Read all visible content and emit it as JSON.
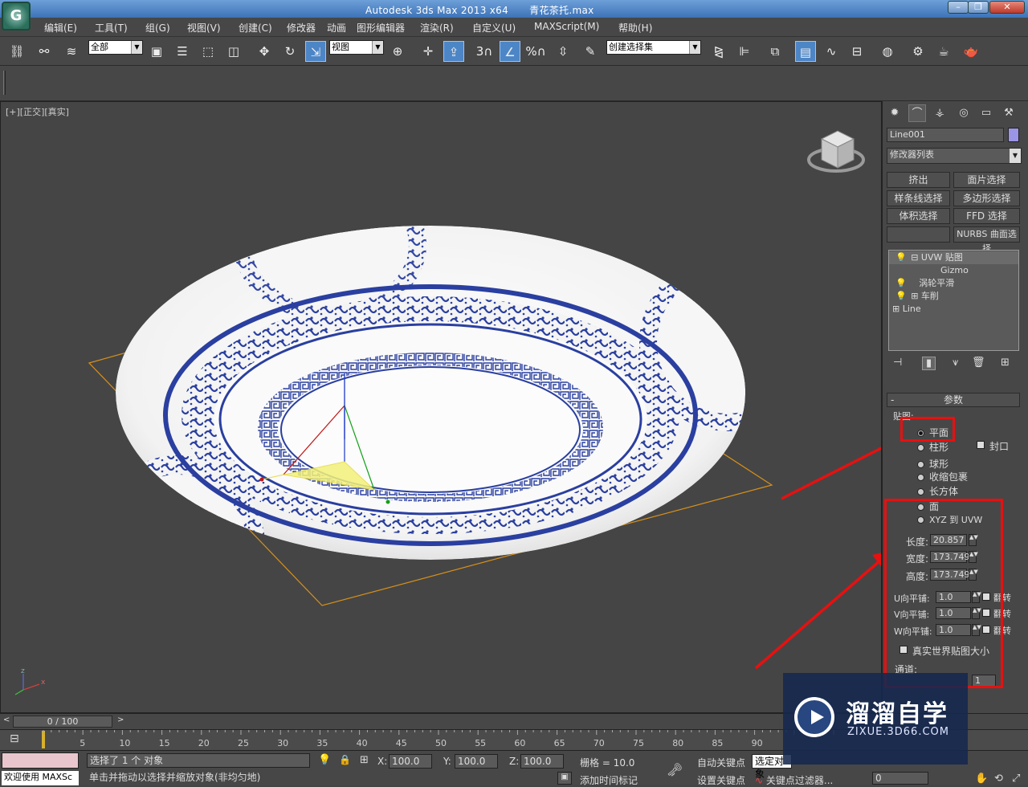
{
  "window": {
    "app": "Autodesk 3ds Max  2013 x64",
    "file": "青花茶托.max"
  },
  "menu": [
    "编辑(E)",
    "工具(T)",
    "组(G)",
    "视图(V)",
    "创建(C)",
    "修改器",
    "动画",
    "图形编辑器",
    "渲染(R)",
    "自定义(U)",
    "MAXScript(M)",
    "帮助(H)"
  ],
  "toolbar": {
    "selection_filter": "全部",
    "ref_coord": "视图",
    "named_selection": "创建选择集",
    "snap_3": "3",
    "percent": "%"
  },
  "viewport": {
    "label": "[+][正交][真实]",
    "axis_z": "z",
    "axis_x": "x"
  },
  "command_panel": {
    "object_name": "Line001",
    "modifier_list": "修改器列表",
    "quick_buttons": [
      "挤出",
      "面片选择",
      "样条线选择",
      "多边形选择",
      "体积选择",
      "FFD 选择",
      "",
      "NURBS 曲面选择"
    ],
    "stack": [
      {
        "label": "UVW 贴图",
        "selected": true
      },
      {
        "label": "Gizmo",
        "selected": false
      },
      {
        "label": "涡轮平滑",
        "selected": false
      },
      {
        "label": "车削",
        "selected": false
      },
      {
        "label": "Line",
        "selected": false
      }
    ],
    "params_title": "参数",
    "mapping_group": "贴图:",
    "mapping_options": [
      "平面",
      "柱形",
      "球形",
      "收缩包裹",
      "长方体",
      "面",
      "XYZ 到 UVW"
    ],
    "mapping_selected": "平面",
    "cap_label": "封口",
    "length_label": "长度:",
    "length_value": "20.857",
    "width_label": "宽度:",
    "width_value": "173.749",
    "height_label": "高度:",
    "height_value": "173.749",
    "u_tile_label": "U向平铺:",
    "u_tile_value": "1.0",
    "v_tile_label": "V向平铺:",
    "v_tile_value": "1.0",
    "w_tile_label": "W向平铺:",
    "w_tile_value": "1.0",
    "flip_label": "翻转",
    "real_world_label": "真实世界贴图大小",
    "channel_label": "通道:",
    "channel_value": "1"
  },
  "timeline": {
    "frame_display": "0 / 100",
    "ticks": [
      "0",
      "5",
      "10",
      "15",
      "20",
      "25",
      "30",
      "35",
      "40",
      "45",
      "50",
      "55",
      "60",
      "65",
      "70",
      "75",
      "80",
      "85",
      "90"
    ]
  },
  "status": {
    "welcome": "欢迎使用 MAXSc",
    "selected": "选择了 1 个 对象",
    "hint": "单击并拖动以选择并缩放对象(非均匀地)",
    "x_label": "X:",
    "x_value": "100.0",
    "y_label": "Y:",
    "y_value": "100.0",
    "z_label": "Z:",
    "z_value": "100.0",
    "grid": "栅格 = 10.0",
    "auto_key": "自动关键点",
    "set_key": "设置关键点",
    "selected_object": "选定对象",
    "key_filters": "关键点过滤器...",
    "add_time_tag": "添加时间标记",
    "frame_field": "0"
  },
  "watermark": {
    "title": "溜溜自学",
    "url": "ZIXUE.3D66.COM"
  },
  "colors": {
    "annotation_red": "#e81010",
    "plate_blue": "#2a3fa0",
    "selection_orange": "#d8901a"
  }
}
